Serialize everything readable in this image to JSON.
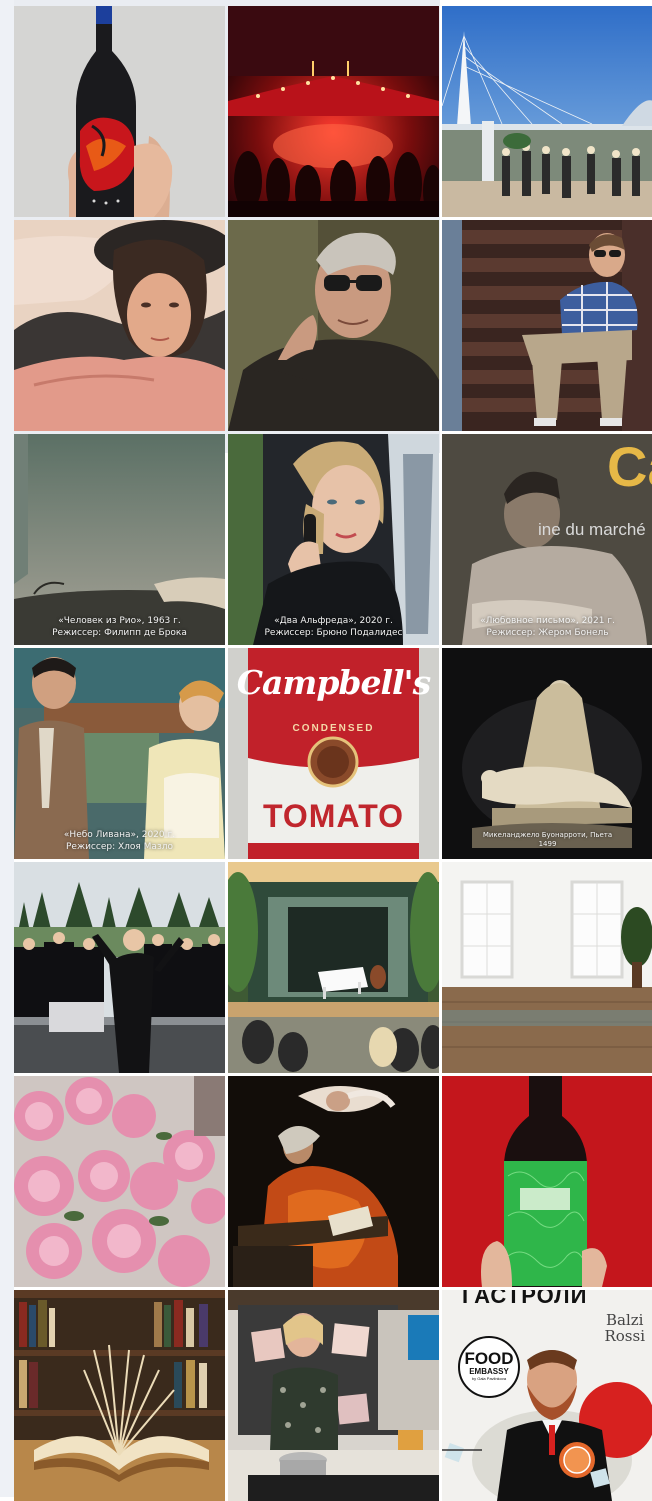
{
  "tiles": [
    {
      "id": "wine-bottle-hand"
    },
    {
      "id": "concert-stage"
    },
    {
      "id": "bridge-outdoor-event"
    },
    {
      "id": "woman-in-bed"
    },
    {
      "id": "man-glasses-portrait"
    },
    {
      "id": "man-on-stairs"
    },
    {
      "id": "film-rio",
      "caption": [
        "«Человек из Рио», 1963 г.",
        "Режиссер: Филипп де Брока"
      ]
    },
    {
      "id": "film-alfred",
      "caption": [
        "«Два Альфреда», 2020 г.",
        "Режиссер: Брюно Подалидес"
      ]
    },
    {
      "id": "film-love-letter",
      "caption": [
        "«Любовное письмо», 2021 г.",
        "Режиссер: Жером Бонель"
      ],
      "sign1": "Ca",
      "sign2": "ine du marché"
    },
    {
      "id": "film-lebanon",
      "caption": [
        "«Небо Ливана», 2020 г.",
        "Режиссер: Хлоя Мазло"
      ]
    },
    {
      "id": "campbell-soup",
      "brand": "Campbell's",
      "subtitle": "CONDENSED",
      "variety": "TOMATO"
    },
    {
      "id": "pieta-sculpture",
      "caption": [
        "Микеланджело Буонарроти, Пьета",
        "1499"
      ]
    },
    {
      "id": "choir-outdoor"
    },
    {
      "id": "garden-concert"
    },
    {
      "id": "white-loft-room"
    },
    {
      "id": "pink-peonies"
    },
    {
      "id": "caravaggio-painting"
    },
    {
      "id": "green-wine-bottle"
    },
    {
      "id": "open-book-library"
    },
    {
      "id": "cooking-show"
    },
    {
      "id": "food-embassy-poster",
      "headline": "ГАСТРОЛИ",
      "restaurant_line1": "Balzi",
      "restaurant_line2": "Rossi",
      "logo_line1": "FOOD",
      "logo_line2": "EMBASSY",
      "logo_line3": "by Gala Pavlinkova"
    }
  ]
}
